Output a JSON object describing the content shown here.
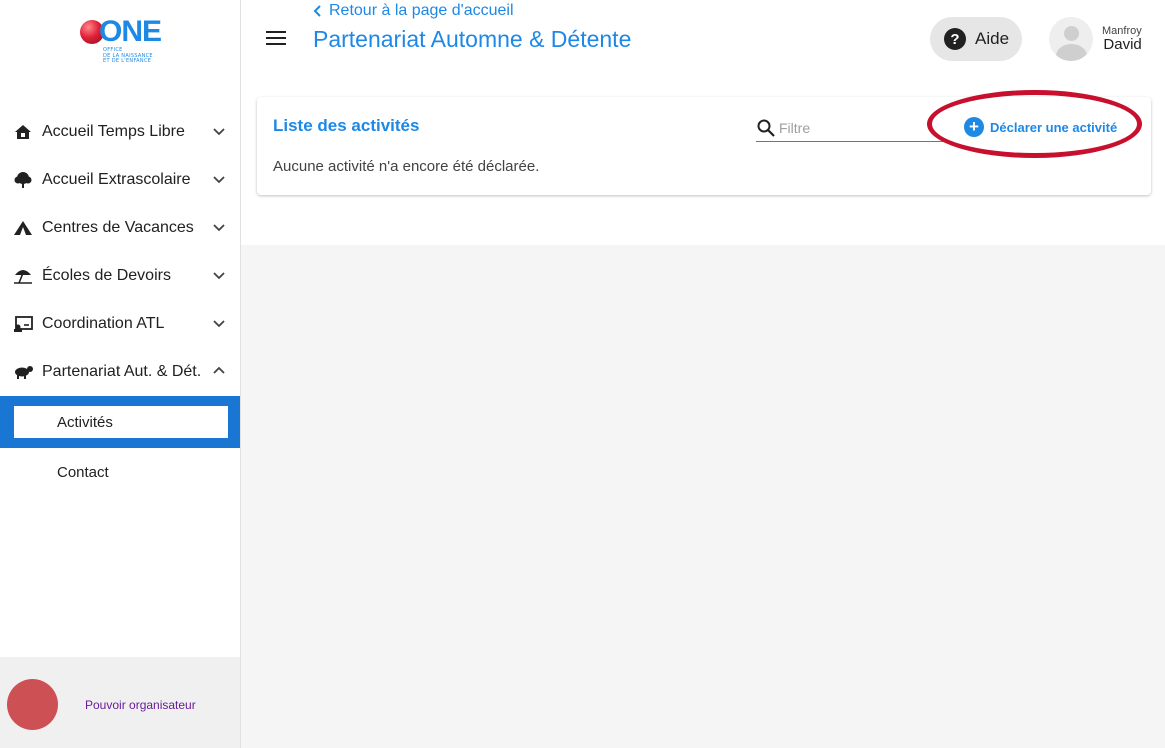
{
  "brand": {
    "logo_word": "ONE",
    "logo_sub": "OFFICE\nDE LA NAISSANCE\nET DE L'ENFANCE",
    "accent": "#1e88e5",
    "ball_color": "#e0213a"
  },
  "sidebar": {
    "items": [
      {
        "label": "Accueil Temps Libre",
        "icon": "house-icon",
        "expanded": false
      },
      {
        "label": "Accueil Extrascolaire",
        "icon": "tree-icon",
        "expanded": false
      },
      {
        "label": "Centres de Vacances",
        "icon": "tent-icon",
        "expanded": false
      },
      {
        "label": "Écoles de Devoirs",
        "icon": "beach-umbrella-icon",
        "expanded": false
      },
      {
        "label": "Coordination ATL",
        "icon": "presentation-icon",
        "expanded": false
      },
      {
        "label": "Partenariat Aut. & Dét.",
        "icon": "animal-icon",
        "expanded": true
      }
    ],
    "subitems": [
      {
        "label": "Activités",
        "active": true
      },
      {
        "label": "Contact",
        "active": false
      }
    ],
    "organisation": {
      "label": "Pouvoir organisateur",
      "avatar_color": "#cd5055"
    }
  },
  "header": {
    "back_label": "Retour à la page d'accueil",
    "title": "Partenariat Automne & Détente",
    "help_label": "Aide",
    "user": {
      "first_name": "Manfroy",
      "last_name": "David"
    }
  },
  "main": {
    "card_title": "Liste des activités",
    "filter_placeholder": "Filtre",
    "declare_label": "Déclarer une activité",
    "empty_message": "Aucune activité n'a encore été déclarée.",
    "highlight_color": "#c8102e"
  }
}
